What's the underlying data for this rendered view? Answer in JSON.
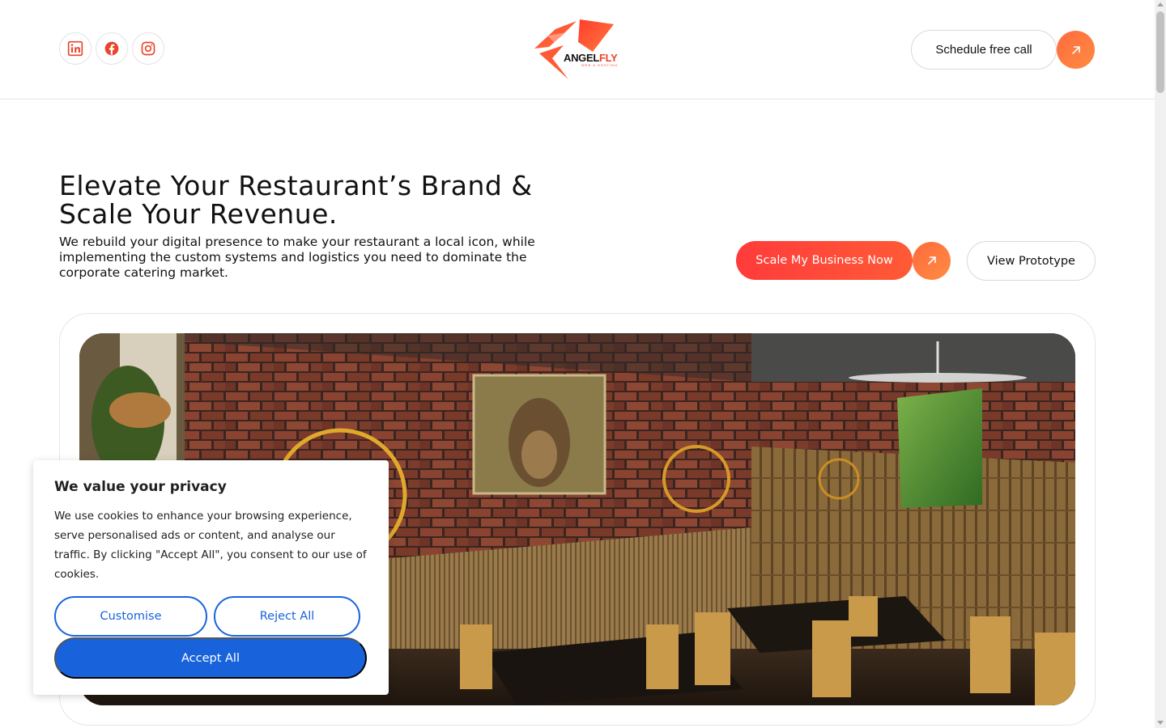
{
  "header": {
    "socials": [
      {
        "icon": "linkedin-icon",
        "color": "#e8452c"
      },
      {
        "icon": "facebook-icon",
        "color": "#e8452c"
      },
      {
        "icon": "instagram-icon",
        "color": "#e8452c"
      }
    ],
    "logo": {
      "part1": "ANGEL",
      "part2": "FLY",
      "sub": "WEB & HOSTING"
    },
    "schedule_label": "Schedule free call"
  },
  "hero": {
    "title": "Elevate Your Restaurant’s Brand & Scale Your Revenue.",
    "subtitle": "We rebuild your digital presence to make your restaurant a local icon, while implementing the custom systems and logistics you need to dominate the corporate catering market.",
    "cta_primary": "Scale My Business Now",
    "cta_secondary": "View Prototype"
  },
  "cookie": {
    "title": "We value your privacy",
    "text": "We use cookies to enhance your browsing experience, serve personalised ads or content, and analyse our traffic. By clicking \"Accept All\", you consent to our use of cookies.",
    "customise": "Customise",
    "reject": "Reject All",
    "accept": "Accept All"
  },
  "colors": {
    "accent": "#ff5a36",
    "cookie_blue": "#1863dc"
  }
}
